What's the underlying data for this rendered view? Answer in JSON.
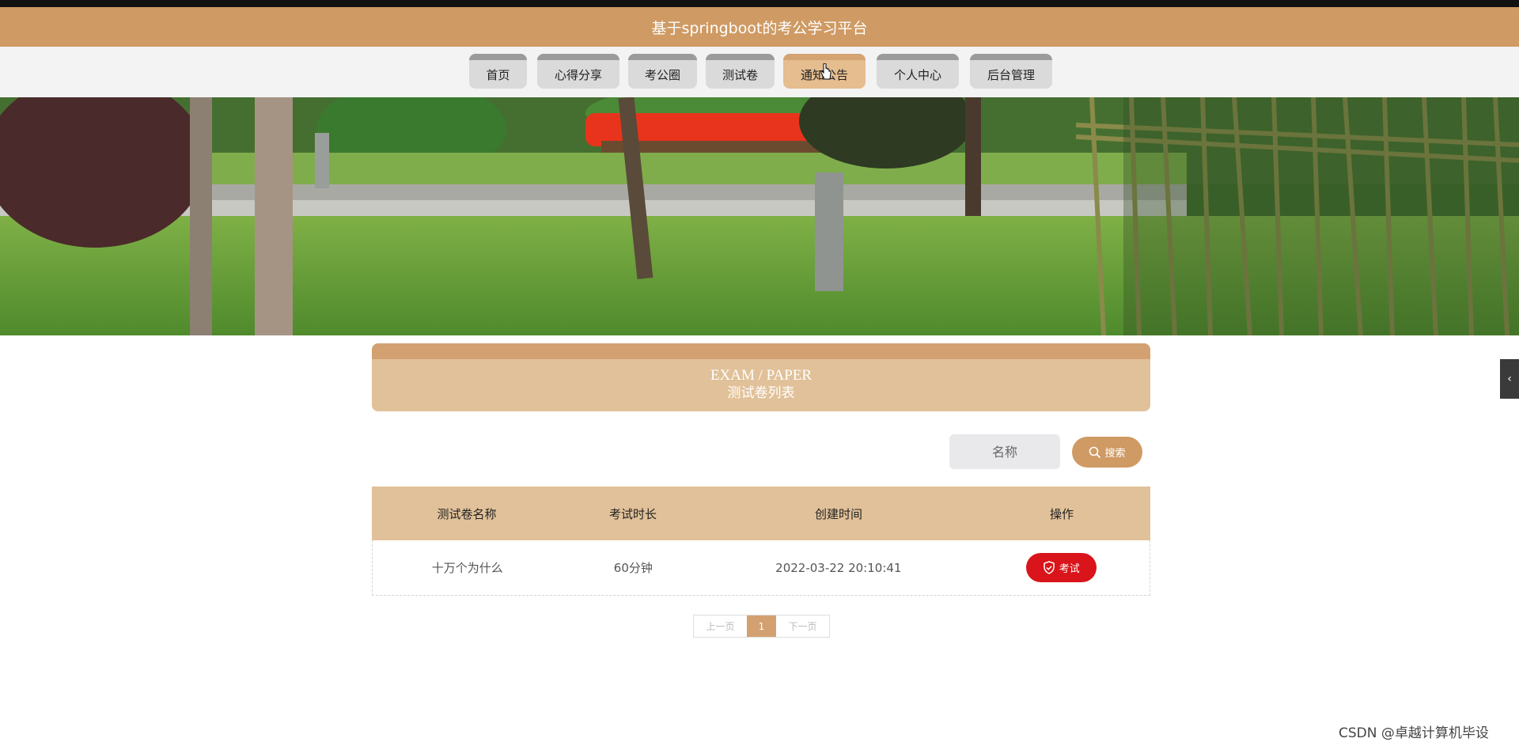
{
  "app": {
    "title": "基于springboot的考公学习平台"
  },
  "nav": {
    "items": [
      {
        "label": "首页"
      },
      {
        "label": "心得分享"
      },
      {
        "label": "考公圈"
      },
      {
        "label": "测试卷"
      },
      {
        "label": "通知公告"
      },
      {
        "label": "个人中心"
      },
      {
        "label": "后台管理"
      }
    ],
    "active": "通知公告"
  },
  "banner": {
    "icon": "garden-scene"
  },
  "section": {
    "title_en": "EXAM / PAPER",
    "title_cn": "测试卷列表"
  },
  "search": {
    "placeholder": "名称",
    "button_label": "搜索"
  },
  "table": {
    "headers": [
      "测试卷名称",
      "考试时长",
      "创建时间",
      "操作"
    ],
    "rows": [
      {
        "name": "十万个为什么",
        "duration": "60分钟",
        "created": "2022-03-22 20:10:41",
        "action": "考试"
      }
    ]
  },
  "pagination": {
    "prev": "上一页",
    "current": "1",
    "next": "下一页"
  },
  "side_toggle": {
    "icon": "chevron-left-icon"
  },
  "watermark": "CSDN @卓越计算机毕设",
  "colors": {
    "brand": "#cf9a63",
    "header_bg": "#e1c199",
    "danger": "#d9141a"
  }
}
